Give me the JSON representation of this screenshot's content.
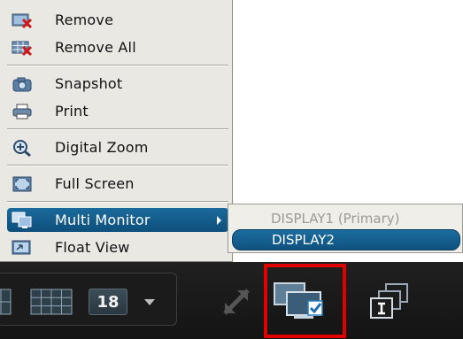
{
  "context_menu": {
    "items": [
      {
        "label": "Remove",
        "icon": "remove-icon"
      },
      {
        "label": "Remove All",
        "icon": "remove-all-icon"
      },
      {
        "label": "Snapshot",
        "icon": "camera-icon"
      },
      {
        "label": "Print",
        "icon": "printer-icon"
      },
      {
        "label": "Digital Zoom",
        "icon": "zoom-icon"
      },
      {
        "label": "Full Screen",
        "icon": "fullscreen-icon"
      },
      {
        "label": "Multi Monitor",
        "icon": "multi-monitor-icon",
        "has_submenu": true,
        "active": true
      },
      {
        "label": "Float View",
        "icon": "float-view-icon"
      }
    ]
  },
  "submenu": {
    "items": [
      {
        "label": "DISPLAY1 (Primary)",
        "state": "disabled"
      },
      {
        "label": "DISPLAY2",
        "state": "selected"
      }
    ]
  },
  "toolbar": {
    "layout_count": "18",
    "icons": [
      "layout-single-icon",
      "layout-grid-icon",
      "layout-count-dropdown",
      "expand-icon",
      "multi-monitor-icon",
      "info-windows-icon"
    ]
  },
  "colors": {
    "menu_bg": "#e9e8e2",
    "highlight_blue": "#0e4f7b",
    "toolbar_bg": "#1a1a1a",
    "callout_red": "#e00000"
  }
}
